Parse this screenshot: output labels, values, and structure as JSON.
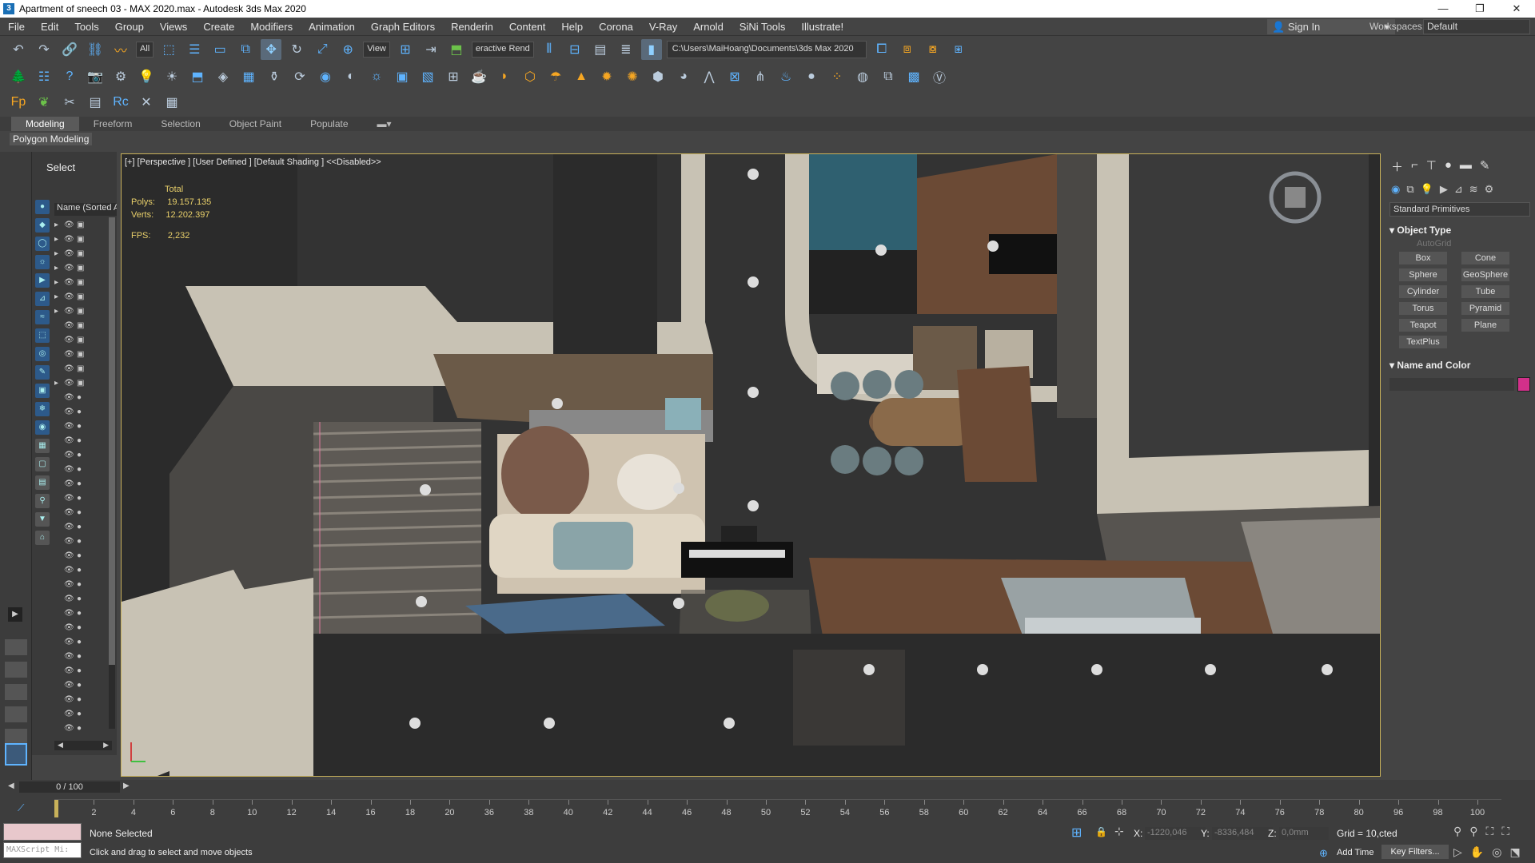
{
  "window": {
    "title": "Apartment of sneech 03 - MAX 2020.max - Autodesk 3ds Max 2020",
    "app_icon_text": "3",
    "controls": [
      "—",
      "❐",
      "✕"
    ]
  },
  "menu": {
    "items": [
      "File",
      "Edit",
      "Tools",
      "Group",
      "Views",
      "Create",
      "Modifiers",
      "Animation",
      "Graph Editors",
      "Renderin",
      "Content",
      "Help",
      "Corona",
      "V-Ray",
      "Arnold",
      "SiNi Tools",
      "Illustrate!"
    ],
    "sign_in": "Sign In",
    "workspaces_label": "Workspaces:",
    "workspace_value": "Default"
  },
  "main_toolbar": {
    "filter_select": "All",
    "view_select": "View",
    "render_label": "eractive Rend",
    "project_path": "C:\\Users\\MaiHoang\\Documents\\3ds Max 2020"
  },
  "ribbon": {
    "tabs": [
      "Modeling",
      "Freeform",
      "Selection",
      "Object Paint",
      "Populate"
    ],
    "active_tab": "Modeling",
    "sub_label": "Polygon Modeling"
  },
  "scene_explorer": {
    "title": "Select",
    "column_header": "Name (Sorted A",
    "row_count": 36
  },
  "viewport": {
    "label": "[+] [Perspective ] [User Defined ] [Default Shading ]  <<Disabled>>",
    "stats": {
      "header": "Total",
      "polys_label": "Polys:",
      "polys_value": "19.157.135",
      "verts_label": "Verts:",
      "verts_value": "12.202.397",
      "fps_label": "FPS:",
      "fps_value": "2,232"
    }
  },
  "command_panel": {
    "dropdown": "Standard Primitives",
    "object_type_title": "Object Type",
    "autogrid": "AutoGrid",
    "buttons": [
      "Box",
      "Cone",
      "Sphere",
      "GeoSphere",
      "Cylinder",
      "Tube",
      "Torus",
      "Pyramid",
      "Teapot",
      "Plane",
      "TextPlus"
    ],
    "name_color_title": "Name and Color",
    "swatch_color": "#d2308a"
  },
  "timeline": {
    "frame_display": "0 / 100",
    "ticks": [
      "2",
      "4",
      "6",
      "8",
      "10",
      "12",
      "14",
      "16",
      "18",
      "20",
      "36",
      "38",
      "40",
      "42",
      "44",
      "46",
      "48",
      "50",
      "52",
      "54",
      "56",
      "58",
      "60",
      "62",
      "64",
      "66",
      "68",
      "70",
      "72",
      "74",
      "76",
      "78",
      "80",
      "96",
      "98",
      "100"
    ]
  },
  "status": {
    "selection": "None Selected",
    "prompt": "Click and drag to select and move objects",
    "maxscript": "MAXScript Mi:",
    "x_label": "X:",
    "x_value": "-1220,046",
    "y_label": "Y:",
    "y_value": "-8336,484",
    "z_label": "Z:",
    "z_value": "0,0mm",
    "grid": "Grid = 10,",
    "grid_tail": "cted",
    "add_time": "Add Time",
    "key_filters": "Key Filters..."
  }
}
